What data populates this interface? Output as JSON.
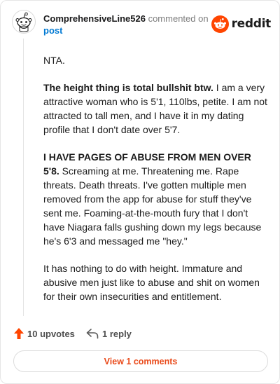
{
  "header": {
    "username": "ComprehensiveLine526",
    "action": "commented on",
    "post_link": "post",
    "brand": "reddit"
  },
  "comment": {
    "p1": "NTA.",
    "p2_bold": "The height thing is total bullshit btw.",
    "p2_rest": " I am a very attractive woman who is 5'1, 110lbs, petite. I am not attracted to tall men, and I have it in my dating profile that I don't date over 5'7.",
    "p3_bold": "I HAVE PAGES OF ABUSE FROM MEN OVER 5'8.",
    "p3_rest": " Screaming at me. Threatening me. Rape threats. Death threats. I've gotten multiple men removed from the app for abuse for stuff they've sent me. Foaming-at-the-mouth fury that I don't have Niagara falls gushing down my legs because he's 6'3 and messaged me \"hey.\"",
    "p4": "It has nothing to do with height. Immature and abusive men just like to abuse and shit on women for their own insecurities and entitlement."
  },
  "footer": {
    "upvotes": "10 upvotes",
    "replies": "1 reply",
    "view_comments": "View 1 comments"
  },
  "colors": {
    "accent": "#ff4500",
    "link": "#0079d3",
    "view_button_text": "#e94a1a"
  },
  "icons": {
    "avatar": "snoo-avatar-icon",
    "brand": "reddit-logo-icon",
    "upvote": "upvote-arrow-icon",
    "reply": "reply-arrow-icon"
  }
}
